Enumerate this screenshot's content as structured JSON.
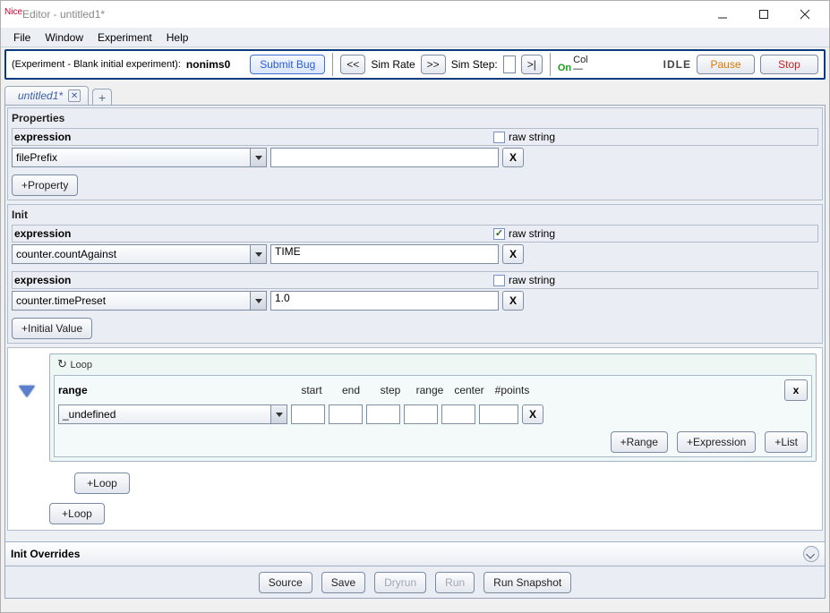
{
  "titlebar": {
    "appname": "Nice",
    "title": "Editor - untitled1*"
  },
  "menubar": {
    "file": "File",
    "window": "Window",
    "experiment": "Experiment",
    "help": "Help"
  },
  "toolbar": {
    "experiment_label": "(Experiment - Blank initial experiment):",
    "username": "nonims0",
    "submit_bug": "Submit Bug",
    "back": "<<",
    "sim_rate": "Sim Rate",
    "fwd": ">>",
    "sim_step": "Sim Step:",
    "sim_step_value": "",
    "step_end": ">|",
    "on": "On",
    "col": "Col",
    "col_sub": "—",
    "idle": "IDLE",
    "pause": "Pause",
    "stop": "Stop"
  },
  "tabs": {
    "name": "untitled1*",
    "add": "+"
  },
  "properties": {
    "title": "Properties",
    "expression_label": "expression",
    "raw_string": "raw string",
    "dropdown": "filePrefix",
    "value": "",
    "remove": "X",
    "add_property": "+Property"
  },
  "init": {
    "title": "Init",
    "rows": [
      {
        "expression_label": "expression",
        "raw_string": "raw string",
        "raw_checked": true,
        "dropdown": "counter.countAgainst",
        "value": "TIME",
        "remove": "X"
      },
      {
        "expression_label": "expression",
        "raw_string": "raw string",
        "raw_checked": false,
        "dropdown": "counter.timePreset",
        "value": "1.0",
        "remove": "X"
      }
    ],
    "add_initial": "+Initial Value"
  },
  "loop": {
    "tab_label": "Loop",
    "range_label": "range",
    "cols": {
      "start": "start",
      "end": "end",
      "step": "step",
      "range": "range",
      "center": "center",
      "points": "#points"
    },
    "dropdown": "_undefined",
    "remove_row": "X",
    "remove_loop": "x",
    "add_range": "+Range",
    "add_expression": "+Expression",
    "add_list": "+List",
    "add_loop": "+Loop",
    "add_loop_outer": "+Loop"
  },
  "init_overrides": {
    "title": "Init Overrides"
  },
  "bottom": {
    "source": "Source",
    "save": "Save",
    "dryrun": "Dryrun",
    "run": "Run",
    "snapshot": "Run Snapshot"
  }
}
